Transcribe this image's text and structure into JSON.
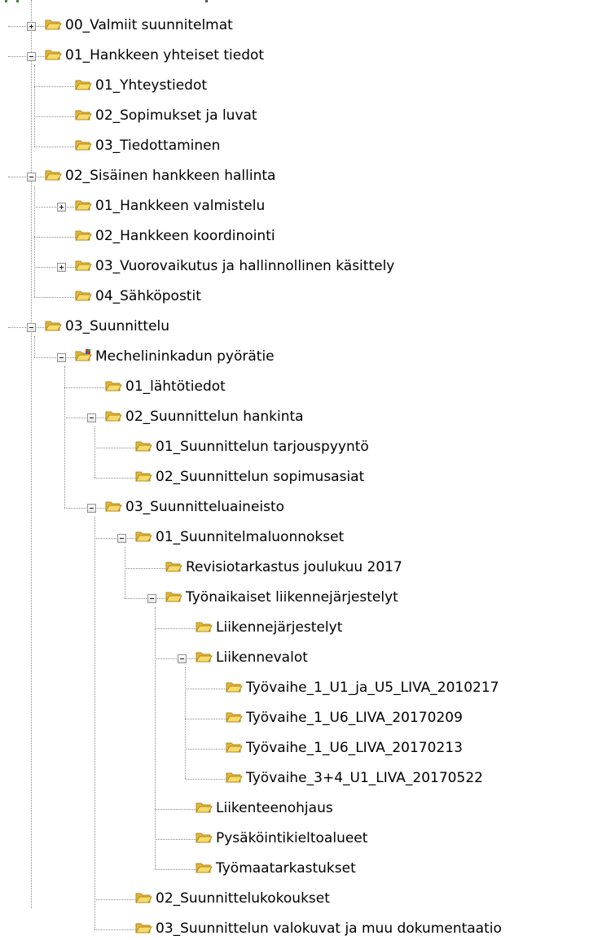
{
  "folder_tree": {
    "items": [
      {
        "label": "00_Valmiit suunnitelmat",
        "depth": 0,
        "expander": "plus",
        "icon": "folder-icon"
      },
      {
        "label": "01_Hankkeen yhteiset tiedot",
        "depth": 0,
        "expander": "minus",
        "icon": "folder-icon"
      },
      {
        "label": "01_Yhteystiedot",
        "depth": 1,
        "expander": "none",
        "icon": "folder-icon"
      },
      {
        "label": "02_Sopimukset ja luvat",
        "depth": 1,
        "expander": "none",
        "icon": "folder-icon"
      },
      {
        "label": "03_Tiedottaminen",
        "depth": 1,
        "expander": "none",
        "icon": "folder-icon"
      },
      {
        "label": "02_Sisäinen hankkeen hallinta",
        "depth": 0,
        "expander": "minus",
        "icon": "folder-icon"
      },
      {
        "label": "01_Hankkeen valmistelu",
        "depth": 1,
        "expander": "plus",
        "icon": "folder-icon"
      },
      {
        "label": "02_Hankkeen koordinointi",
        "depth": 1,
        "expander": "none",
        "icon": "folder-icon"
      },
      {
        "label": "03_Vuorovaikutus ja hallinnollinen käsittely",
        "depth": 1,
        "expander": "plus",
        "icon": "folder-icon"
      },
      {
        "label": "04_Sähköpostit",
        "depth": 1,
        "expander": "none",
        "icon": "folder-icon"
      },
      {
        "label": "03_Suunnittelu",
        "depth": 0,
        "expander": "minus",
        "icon": "folder-icon"
      },
      {
        "label": "Mechelininkadun pyörätie",
        "depth": 1,
        "expander": "minus",
        "icon": "project-folder-icon"
      },
      {
        "label": "01_lähtötiedot",
        "depth": 2,
        "expander": "none",
        "icon": "folder-icon"
      },
      {
        "label": "02_Suunnittelun hankinta",
        "depth": 2,
        "expander": "minus",
        "icon": "folder-icon"
      },
      {
        "label": "01_Suunnittelun tarjouspyyntö",
        "depth": 3,
        "expander": "none",
        "icon": "folder-icon"
      },
      {
        "label": "02_Suunnittelun sopimusasiat",
        "depth": 3,
        "expander": "none",
        "icon": "folder-icon"
      },
      {
        "label": "03_Suunnitteluaineisto",
        "depth": 2,
        "expander": "minus",
        "icon": "folder-icon"
      },
      {
        "label": "01_Suunnitelmaluonnokset",
        "depth": 3,
        "expander": "minus",
        "icon": "folder-icon"
      },
      {
        "label": "Revisiotarkastus joulukuu 2017",
        "depth": 4,
        "expander": "none",
        "icon": "folder-icon"
      },
      {
        "label": "Työnaikaiset liikennejärjestelyt",
        "depth": 4,
        "expander": "minus",
        "icon": "folder-icon"
      },
      {
        "label": "Liikennejärjestelyt",
        "depth": 5,
        "expander": "none",
        "icon": "folder-icon"
      },
      {
        "label": "Liikennevalot",
        "depth": 5,
        "expander": "minus",
        "icon": "folder-icon"
      },
      {
        "label": "Työvaihe_1_U1_ja_U5_LIVA_2010217",
        "depth": 6,
        "expander": "none",
        "icon": "folder-icon"
      },
      {
        "label": "Työvaihe_1_U6_LIVA_20170209",
        "depth": 6,
        "expander": "none",
        "icon": "folder-icon"
      },
      {
        "label": "Työvaihe_1_U6_LIVA_20170213",
        "depth": 6,
        "expander": "none",
        "icon": "folder-icon"
      },
      {
        "label": "Työvaihe_3+4_U1_LIVA_20170522",
        "depth": 6,
        "expander": "none",
        "icon": "folder-icon"
      },
      {
        "label": "Liikenteenohjaus",
        "depth": 5,
        "expander": "none",
        "icon": "folder-icon"
      },
      {
        "label": "Pysäköintikieltoalueet",
        "depth": 5,
        "expander": "none",
        "icon": "folder-icon"
      },
      {
        "label": "Työmaatarkastukset",
        "depth": 5,
        "expander": "none",
        "icon": "folder-icon"
      },
      {
        "label": "02_Suunnittelukokoukset",
        "depth": 3,
        "expander": "none",
        "icon": "folder-icon"
      },
      {
        "label": "03_Suunnittelun valokuvat ja muu dokumentaatio",
        "depth": 3,
        "expander": "none",
        "icon": "folder-icon"
      }
    ]
  },
  "colors": {
    "folder_front": "#f5dc6a",
    "folder_back": "#e2b53a",
    "folder_outline": "#b48a1c",
    "connector_line": "#8a8a8a",
    "project_badge_red": "#d12a2a",
    "project_badge_green": "#2f9e3a",
    "project_badge_blue": "#2a5fd1"
  }
}
